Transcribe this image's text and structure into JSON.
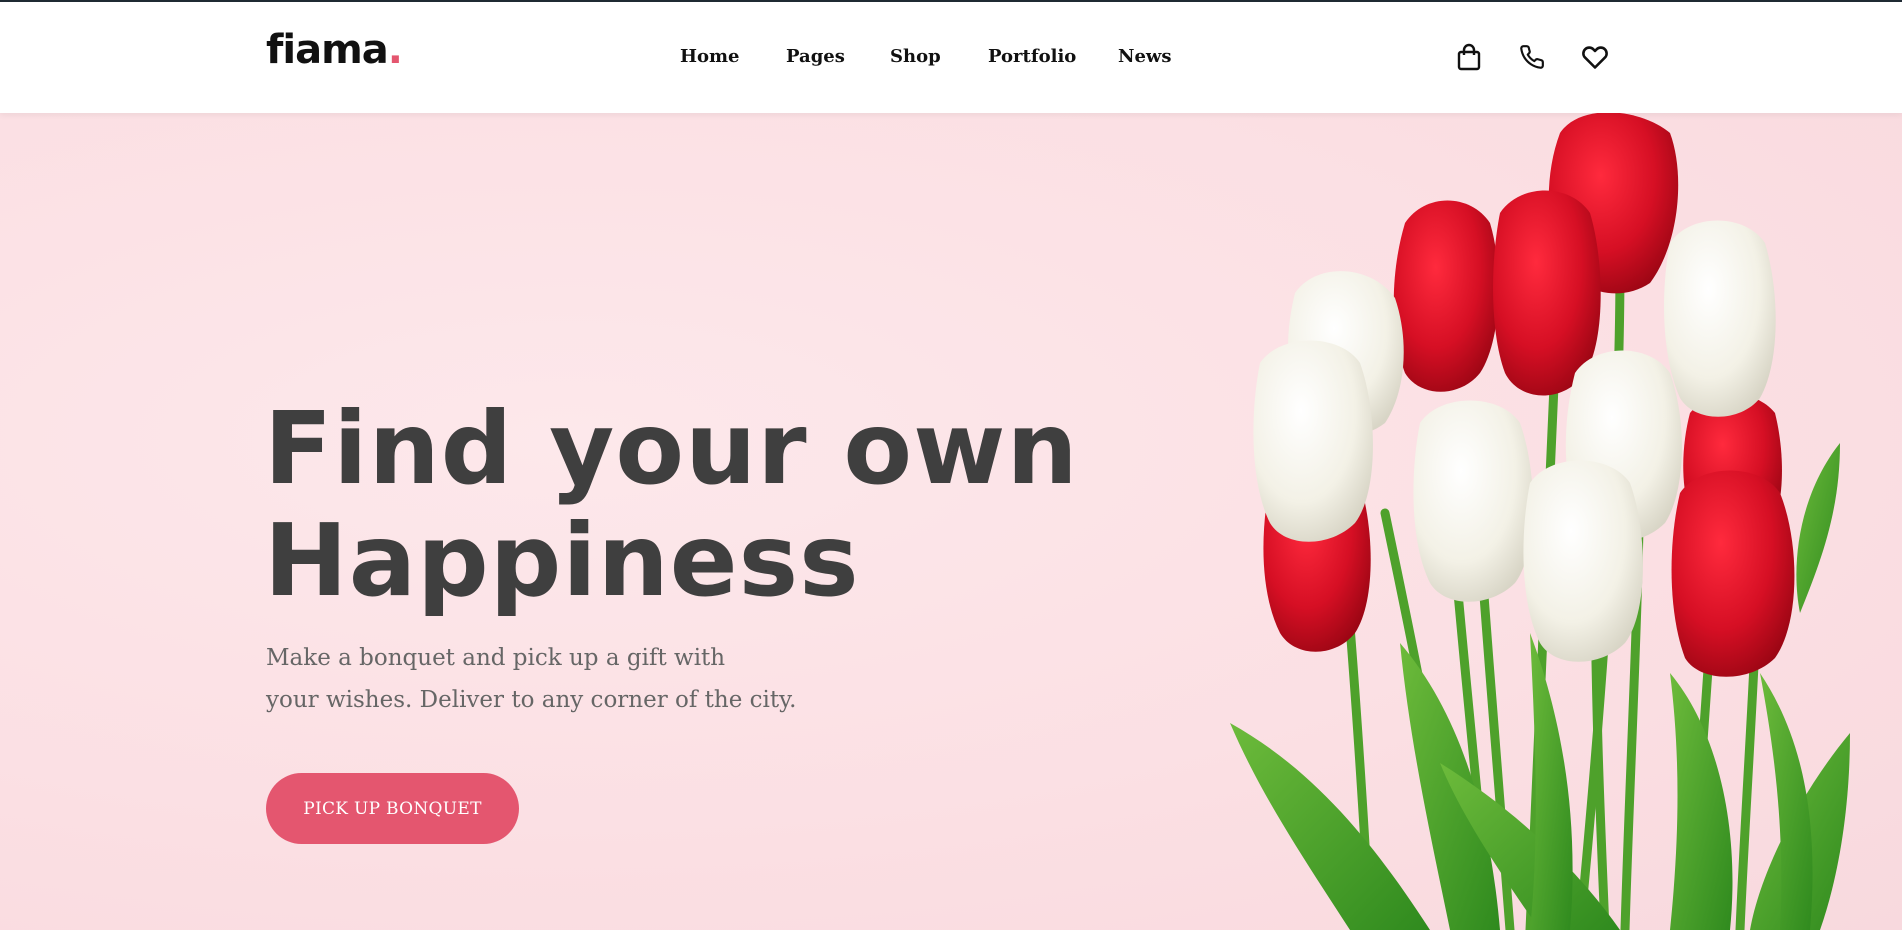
{
  "header": {
    "logo_text": "fiama",
    "logo_dot": ".",
    "nav": [
      {
        "label": "Home"
      },
      {
        "label": "Pages"
      },
      {
        "label": "Shop"
      },
      {
        "label": "Portfolio"
      },
      {
        "label": "News"
      }
    ],
    "icons": [
      "shopping-bag-icon",
      "phone-icon",
      "heart-icon"
    ]
  },
  "hero": {
    "title_line1": "Find your own",
    "title_line2": "Happiness",
    "subtitle_line1": "Make a bonquet and pick up a gift with",
    "subtitle_line2": "your wishes. Deliver to any corner of the city.",
    "cta_label": "PICK UP BONQUET",
    "image": "tulip-bouquet"
  },
  "colors": {
    "accent": "#e4566f",
    "hero_background": "#fbe2e5",
    "title": "#3f3f3f",
    "text": "#666666"
  }
}
